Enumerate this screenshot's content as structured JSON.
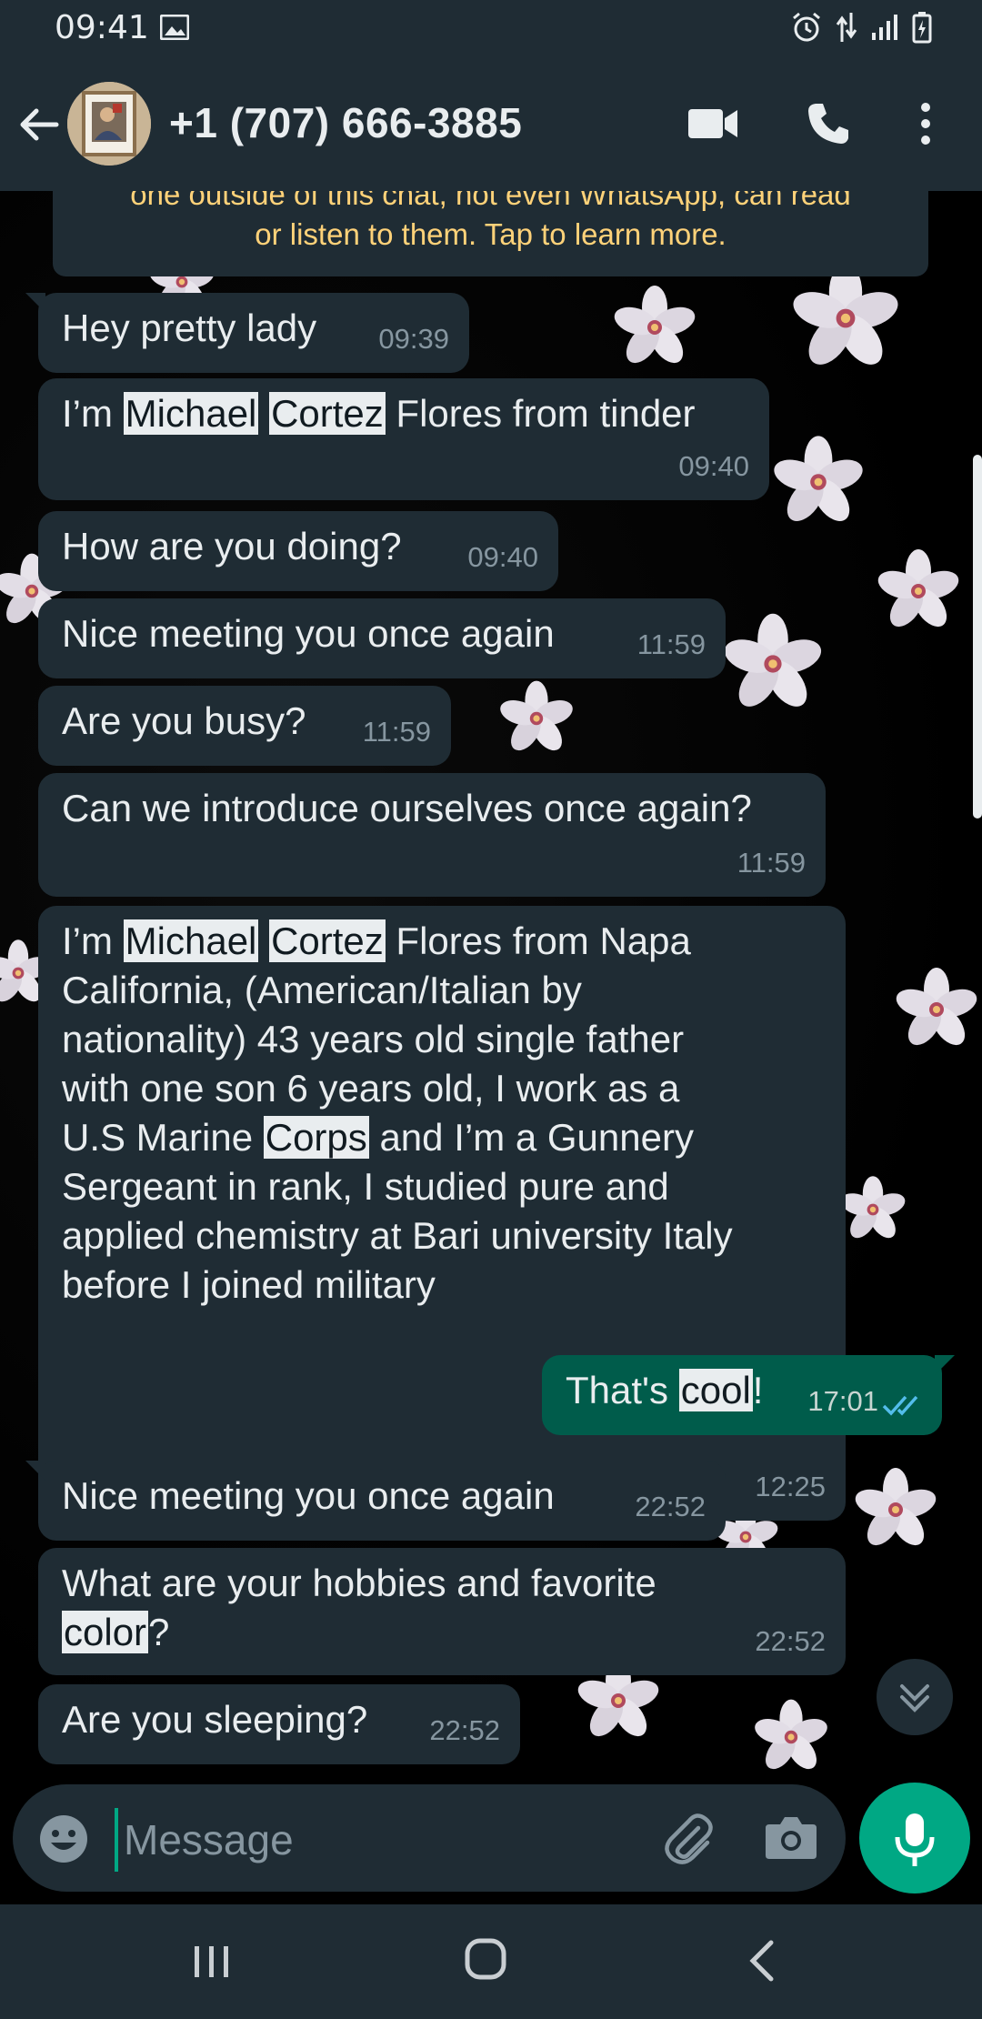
{
  "status_bar": {
    "time": "09:41"
  },
  "header": {
    "contact": "+1 (707) 666-3885"
  },
  "encryption_notice": {
    "line1": "one outside of this chat, not even WhatsApp, can read",
    "line2": "or listen to them. Tap to learn more."
  },
  "messages": [
    {
      "dir": "in",
      "text": "Hey pretty lady",
      "time": "09:39"
    },
    {
      "dir": "in",
      "text": "I’m Michael Cortez Flores from tinder",
      "time": "09:40"
    },
    {
      "dir": "in",
      "text": "How are you doing?",
      "time": "09:40"
    },
    {
      "dir": "in",
      "text": "Nice meeting you once again",
      "time": "11:59"
    },
    {
      "dir": "in",
      "text": "Are you busy?",
      "time": "11:59"
    },
    {
      "dir": "in",
      "text": "Can we introduce ourselves once again?",
      "time": "11:59"
    },
    {
      "dir": "in",
      "text": "I’m Michael Cortez Flores from Napa California, (American/Italian by nationality) 43 years old single father with one son 6 years old, I work as a U.S Marine Corps and I’m a Gunnery Sergeant in rank, I studied pure and applied chemistry at Bari university Italy before I joined military",
      "time": "12:25"
    },
    {
      "dir": "out",
      "text": "That's cool!",
      "time": "17:01"
    },
    {
      "dir": "in",
      "text": "Nice meeting you once again",
      "time": "22:52"
    },
    {
      "dir": "in",
      "text": "What are your hobbies and favorite color?",
      "time": "22:52"
    },
    {
      "dir": "in",
      "text": "Are you sleeping?",
      "time": "22:52"
    }
  ],
  "composer": {
    "placeholder": "Message"
  },
  "colors": {
    "bar": "#1f2c34",
    "incoming_bubble": "#1f2c34",
    "outgoing_bubble": "#005c4b",
    "accent": "#00a884",
    "notice_text": "#ffd279",
    "meta_text": "#8696a0"
  }
}
